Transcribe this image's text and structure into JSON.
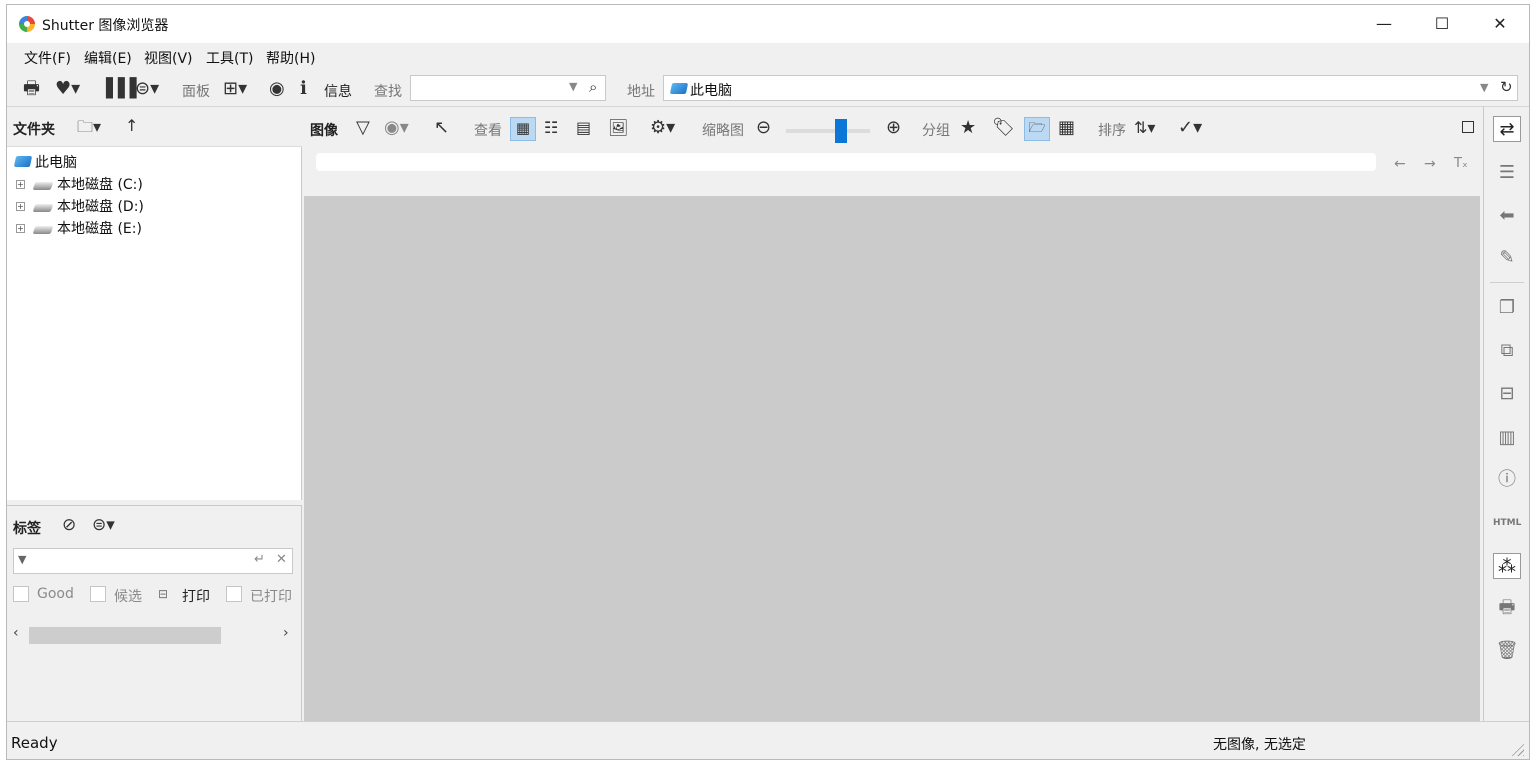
{
  "window": {
    "title": "Shutter 图像浏览器",
    "minimize": "—",
    "maximize": "☐",
    "close": "✕"
  },
  "menu": [
    {
      "label": "文件(F)"
    },
    {
      "label": "编辑(E)"
    },
    {
      "label": "视图(V)"
    },
    {
      "label": "工具(T)"
    },
    {
      "label": "帮助(H)"
    }
  ],
  "toolbar": {
    "panel_label": "面板",
    "info_label": "信息",
    "find_label": "查找",
    "search_value": "",
    "address_label": "地址",
    "address_value": "此电脑"
  },
  "folders": {
    "title": "文件夹",
    "tree": [
      {
        "label": "此电脑"
      },
      {
        "label": "本地磁盘 (C:)"
      },
      {
        "label": "本地磁盘 (D:)"
      },
      {
        "label": "本地磁盘 (E:)"
      }
    ]
  },
  "tags": {
    "title": "标签",
    "filter_value": "",
    "items": [
      {
        "label": "Good"
      },
      {
        "label": "候选"
      },
      {
        "label": "打印"
      },
      {
        "label": "已打印"
      }
    ]
  },
  "image_toolbar": {
    "image_label": "图像",
    "view_label": "查看",
    "thumbnail_label": "缩略图",
    "thumbnail_zoom_level": 0.65,
    "group_label": "分组",
    "sort_label": "排序"
  },
  "status": {
    "left": "Ready",
    "right": "无图像, 无选定"
  },
  "colors": {
    "accent": "#0b76d8",
    "highlight": "#bcd9f3",
    "canvas": "#cbcbcb"
  }
}
